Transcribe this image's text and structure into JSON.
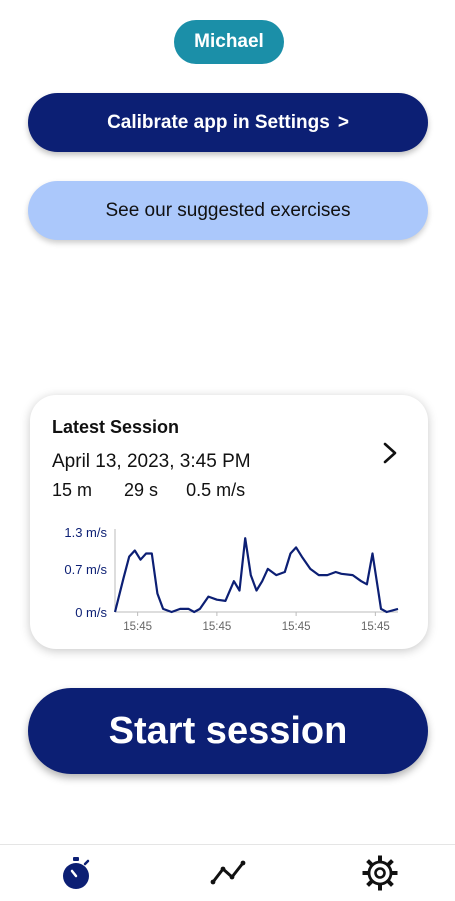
{
  "user": {
    "name": "Michael"
  },
  "buttons": {
    "calibrate_label": "Calibrate app in Settings",
    "calibrate_chevron": ">",
    "exercises_label": "See our suggested exercises",
    "start_label": "Start session"
  },
  "latest_session": {
    "title": "Latest Session",
    "date": "April 13, 2023, 3:45 PM",
    "distance": "15 m",
    "duration": "29 s",
    "speed": "0.5 m/s"
  },
  "chart_data": {
    "type": "line",
    "y_ticks": [
      "1.3 m/s",
      "0.7 m/s",
      "0 m/s"
    ],
    "x_ticks": [
      "15:45",
      "15:45",
      "15:45",
      "15:45"
    ],
    "ylim": [
      0,
      1.3
    ],
    "xlim": [
      0,
      1
    ],
    "grid": false,
    "line_color": "#0c1f74",
    "series": [
      {
        "points": [
          [
            0.0,
            0.0
          ],
          [
            0.03,
            0.55
          ],
          [
            0.05,
            0.9
          ],
          [
            0.07,
            1.0
          ],
          [
            0.09,
            0.85
          ],
          [
            0.11,
            0.95
          ],
          [
            0.13,
            0.95
          ],
          [
            0.15,
            0.3
          ],
          [
            0.17,
            0.05
          ],
          [
            0.2,
            0.0
          ],
          [
            0.23,
            0.05
          ],
          [
            0.26,
            0.05
          ],
          [
            0.28,
            0.0
          ],
          [
            0.3,
            0.05
          ],
          [
            0.33,
            0.25
          ],
          [
            0.36,
            0.2
          ],
          [
            0.39,
            0.18
          ],
          [
            0.42,
            0.5
          ],
          [
            0.44,
            0.35
          ],
          [
            0.46,
            1.2
          ],
          [
            0.48,
            0.6
          ],
          [
            0.5,
            0.35
          ],
          [
            0.52,
            0.5
          ],
          [
            0.54,
            0.7
          ],
          [
            0.57,
            0.6
          ],
          [
            0.6,
            0.65
          ],
          [
            0.62,
            0.95
          ],
          [
            0.64,
            1.05
          ],
          [
            0.66,
            0.9
          ],
          [
            0.69,
            0.7
          ],
          [
            0.72,
            0.6
          ],
          [
            0.75,
            0.6
          ],
          [
            0.78,
            0.65
          ],
          [
            0.8,
            0.62
          ],
          [
            0.84,
            0.6
          ],
          [
            0.87,
            0.5
          ],
          [
            0.89,
            0.45
          ],
          [
            0.91,
            0.95
          ],
          [
            0.93,
            0.35
          ],
          [
            0.94,
            0.05
          ],
          [
            0.96,
            0.0
          ],
          [
            1.0,
            0.05
          ]
        ]
      }
    ]
  },
  "tabs": [
    {
      "icon": "stopwatch-icon",
      "label": "session"
    },
    {
      "icon": "trend-icon",
      "label": "history"
    },
    {
      "icon": "gear-icon",
      "label": "settings"
    }
  ],
  "colors": {
    "primary": "#0c1f74",
    "accent": "#1b8fa8",
    "light": "#abc8fb"
  }
}
